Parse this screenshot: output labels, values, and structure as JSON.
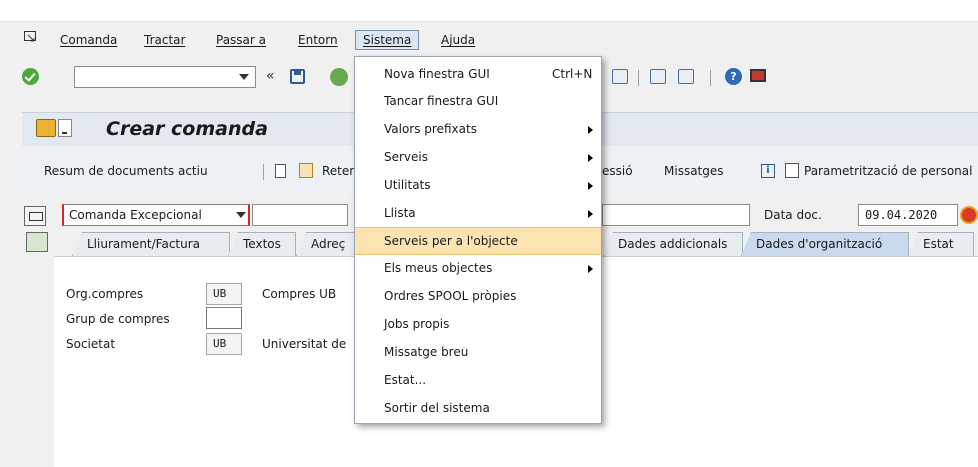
{
  "menubar": {
    "items": [
      {
        "label": "Comanda"
      },
      {
        "label": "Tractar"
      },
      {
        "label": "Passar a"
      },
      {
        "label": "Entorn"
      },
      {
        "label": "Sistema"
      },
      {
        "label": "Ajuda"
      }
    ]
  },
  "toolbar": {
    "back_label": "«",
    "command_value": ""
  },
  "title": {
    "text": "Crear comanda"
  },
  "app_toolbar": {
    "doc_summary": "Resum de documents actiu",
    "hold": "Retenir",
    "print_preview_tail": "essió",
    "messages": "Missatges",
    "personal_settings": "Parametrització de personal"
  },
  "header": {
    "order_type": "Comanda Excepcional",
    "doc_date_label": "Data doc.",
    "doc_date": "09.04.2020"
  },
  "tabs": [
    {
      "label": "Lliurament/Factura"
    },
    {
      "label": "Textos"
    },
    {
      "label": "Adreç"
    },
    {
      "label": "Dades addicionals"
    },
    {
      "label": "Dades d'organització"
    },
    {
      "label": "Estat"
    }
  ],
  "org_data": {
    "purch_org_label": "Org.compres",
    "purch_org_value": "UB",
    "purch_org_desc": "Compres UB",
    "purch_group_label": "Grup de compres",
    "company_label": "Societat",
    "company_value": "UB",
    "company_desc": "Universitat de"
  },
  "sistema_menu": {
    "items": [
      {
        "label": "Nova finestra GUI",
        "shortcut": "Ctrl+N"
      },
      {
        "label": "Tancar finestra GUI"
      },
      {
        "label": "Valors prefixats"
      },
      {
        "label": "Serveis"
      },
      {
        "label": "Utilitats"
      },
      {
        "label": "Llista"
      },
      {
        "label": "Serveis per a l'objecte"
      },
      {
        "label": "Els meus objectes"
      },
      {
        "label": "Ordres SPOOL pròpies"
      },
      {
        "label": "Jobs propis"
      },
      {
        "label": "Missatge breu"
      },
      {
        "label": "Estat..."
      },
      {
        "label": "Sortir del sistema"
      }
    ]
  },
  "colors": {
    "menu_highlight": "#fbe4b0",
    "required_marker": "#dd2222",
    "active_tab": "#c9d9ee"
  }
}
